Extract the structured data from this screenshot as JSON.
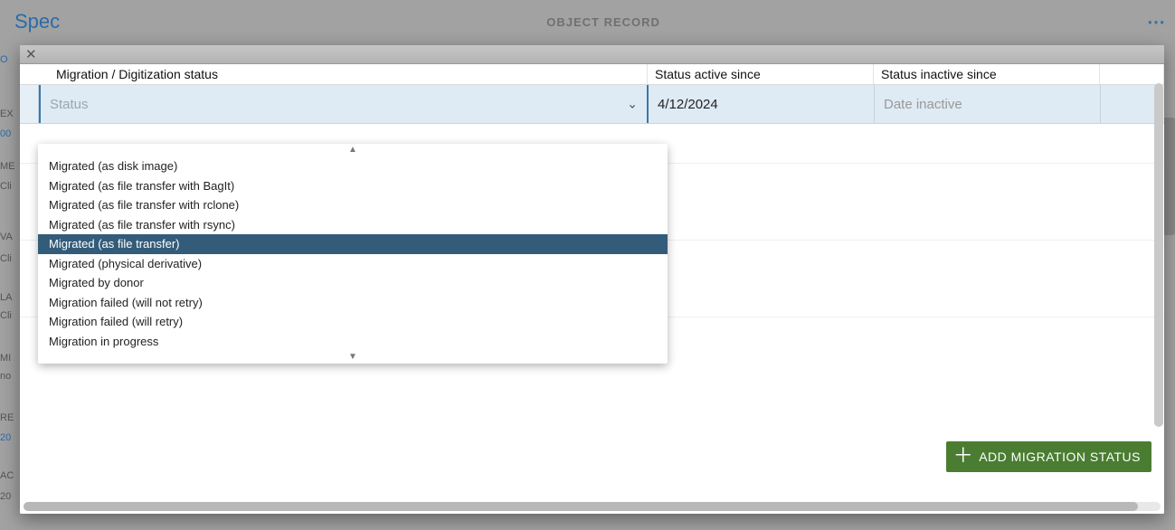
{
  "header": {
    "page_title": "Spec",
    "center_label": "OBJECT RECORD"
  },
  "sidebar_fragments": [
    "O",
    "EX",
    "00",
    "ME",
    "Cli",
    "VA",
    "Cli",
    "LA",
    "Cli",
    "MI",
    "no",
    "RE",
    "20",
    "AC",
    "20"
  ],
  "grid": {
    "headers": {
      "status": "Migration / Digitization status",
      "active": "Status active since",
      "inactive": "Status inactive since"
    },
    "row": {
      "status_placeholder": "Status",
      "status_value": "",
      "active_value": "4/12/2024",
      "inactive_placeholder": "Date inactive"
    }
  },
  "dropdown": {
    "options": [
      "Migrated (as disk image)",
      "Migrated (as file transfer with BagIt)",
      "Migrated (as file transfer with rclone)",
      "Migrated (as file transfer with rsync)",
      "Migrated (as file transfer)",
      "Migrated (physical derivative)",
      "Migrated by donor",
      "Migration failed (will not retry)",
      "Migration failed (will retry)",
      "Migration in progress"
    ],
    "selected_index": 4
  },
  "footer": {
    "add_button_label": "ADD MIGRATION STATUS"
  }
}
